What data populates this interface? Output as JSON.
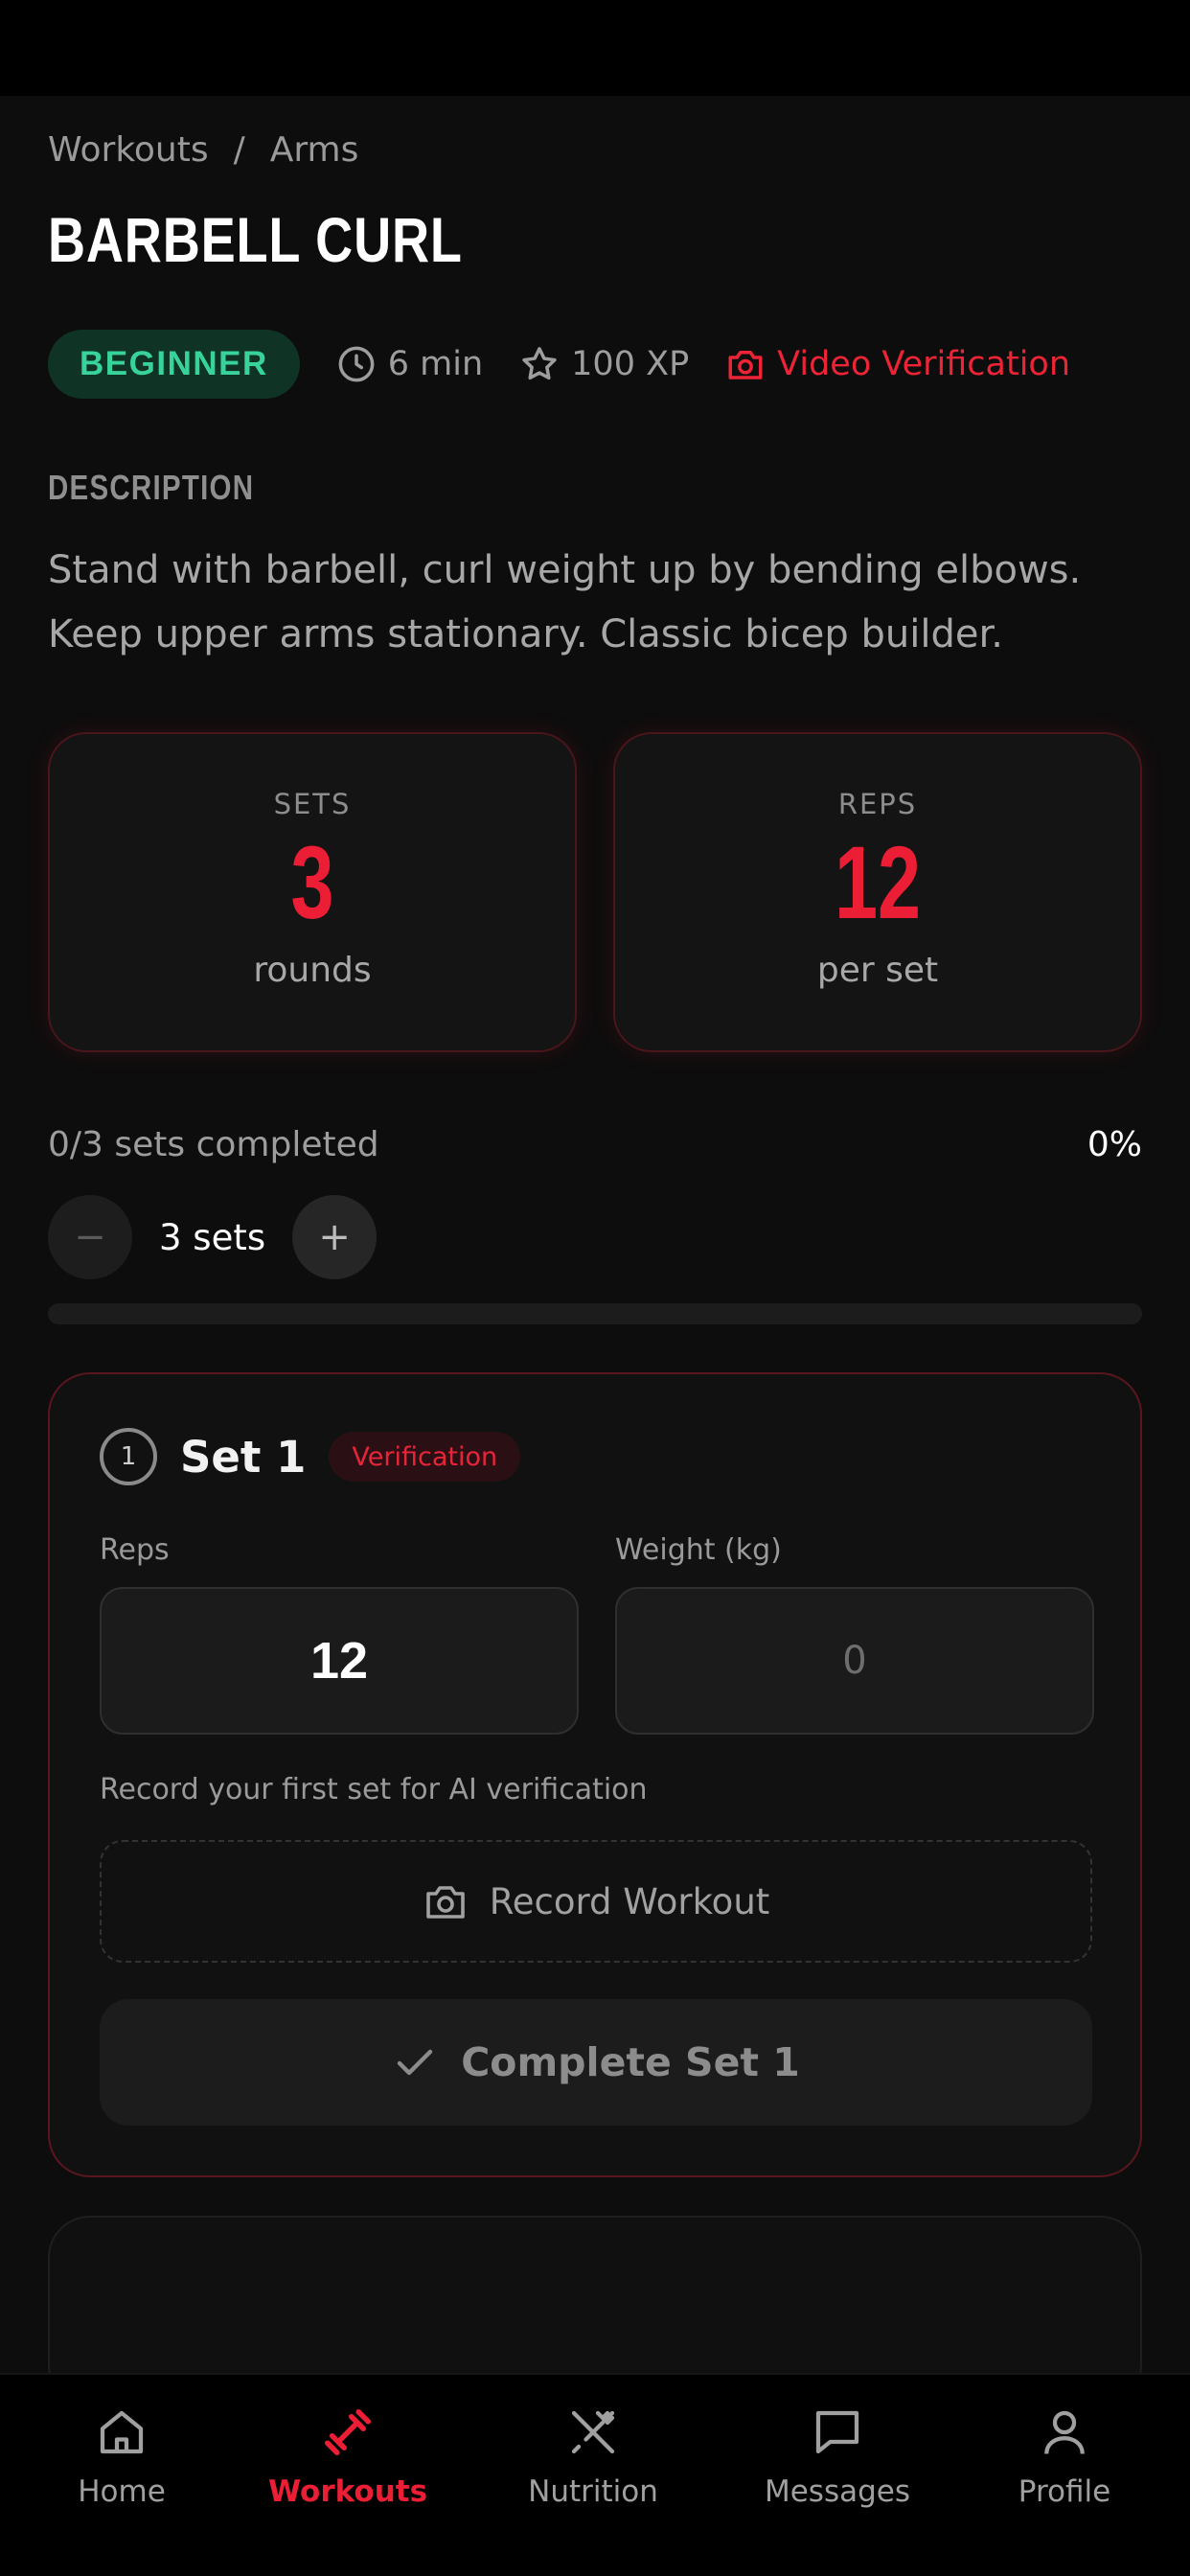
{
  "breadcrumb": {
    "parent": "Workouts",
    "separator": "/",
    "current": "Arms"
  },
  "exercise": {
    "title": "BARBELL CURL",
    "level": "BEGINNER",
    "duration": "6 min",
    "xp": "100 XP",
    "verification": "Video Verification",
    "description_label": "DESCRIPTION",
    "description": "Stand with barbell, curl weight up by bending elbows. Keep upper arms stationary. Classic bicep builder."
  },
  "stats": {
    "sets": {
      "label": "SETS",
      "value": "3",
      "unit": "rounds"
    },
    "reps": {
      "label": "REPS",
      "value": "12",
      "unit": "per set"
    }
  },
  "progress": {
    "text": "0/3 sets completed",
    "percent": "0%",
    "fraction": 0,
    "stepper_value": "3 sets",
    "minus": "−",
    "plus": "+"
  },
  "set1": {
    "number": "1",
    "title": "Set 1",
    "chip": "Verification",
    "reps_label": "Reps",
    "reps_value": "12",
    "weight_label": "Weight (kg)",
    "weight_value": "0",
    "hint": "Record your first set for AI verification",
    "record_label": "Record Workout",
    "complete_label": "Complete Set 1"
  },
  "colors": {
    "accent": "#ec1e36",
    "success": "#37d39a",
    "background": "#0d0d0d"
  },
  "tabs": [
    {
      "label": "Home",
      "icon": "home-icon"
    },
    {
      "label": "Workouts",
      "icon": "dumbbell-icon",
      "active": true
    },
    {
      "label": "Nutrition",
      "icon": "utensils-icon"
    },
    {
      "label": "Messages",
      "icon": "message-icon"
    },
    {
      "label": "Profile",
      "icon": "user-icon"
    }
  ]
}
